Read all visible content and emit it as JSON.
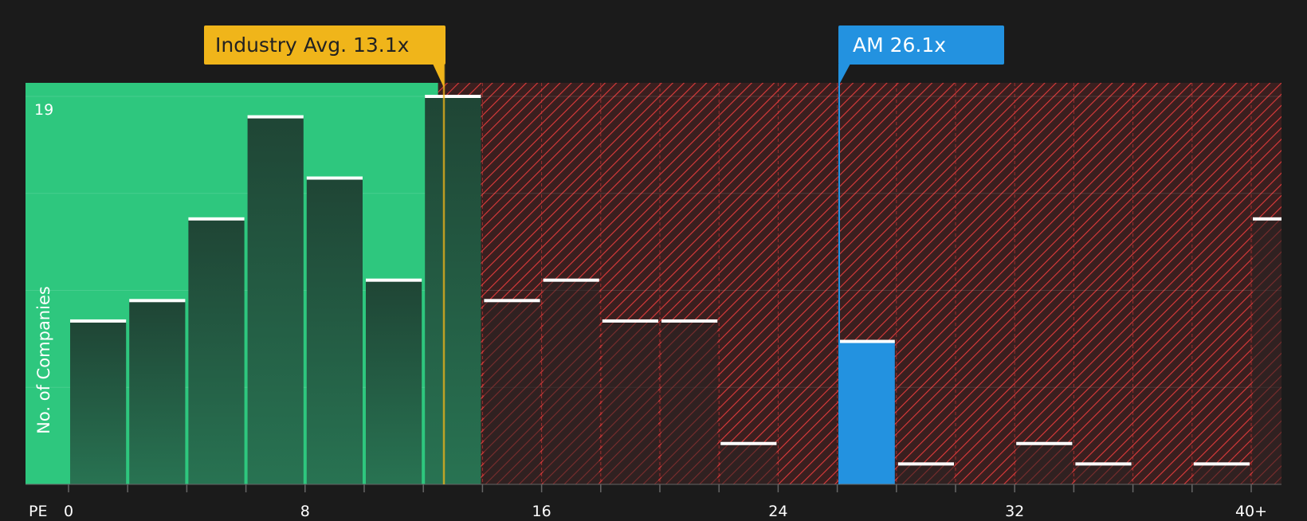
{
  "chart_data": {
    "type": "bar",
    "title": "",
    "xlabel": "PE",
    "ylabel": "No. of Companies",
    "x_ticks": [
      "0",
      "8",
      "16",
      "24",
      "32",
      "40+"
    ],
    "y_max_label": "19",
    "ylim": [
      0,
      19
    ],
    "xlim": [
      0,
      41
    ],
    "bin_width": 2,
    "bars": [
      {
        "x0": 0,
        "x1": 2,
        "value": 8
      },
      {
        "x0": 2,
        "x1": 4,
        "value": 9
      },
      {
        "x0": 4,
        "x1": 6,
        "value": 13
      },
      {
        "x0": 6,
        "x1": 8,
        "value": 18
      },
      {
        "x0": 8,
        "x1": 10,
        "value": 15
      },
      {
        "x0": 10,
        "x1": 12,
        "value": 10
      },
      {
        "x0": 12,
        "x1": 14,
        "value": 19
      },
      {
        "x0": 14,
        "x1": 16,
        "value": 9
      },
      {
        "x0": 16,
        "x1": 18,
        "value": 10
      },
      {
        "x0": 18,
        "x1": 20,
        "value": 8
      },
      {
        "x0": 20,
        "x1": 22,
        "value": 8
      },
      {
        "x0": 22,
        "x1": 24,
        "value": 2
      },
      {
        "x0": 24,
        "x1": 26,
        "value": 0
      },
      {
        "x0": 26,
        "x1": 28,
        "value": 7,
        "highlight": true
      },
      {
        "x0": 28,
        "x1": 30,
        "value": 1
      },
      {
        "x0": 30,
        "x1": 32,
        "value": 0
      },
      {
        "x0": 32,
        "x1": 34,
        "value": 2
      },
      {
        "x0": 34,
        "x1": 36,
        "value": 1
      },
      {
        "x0": 36,
        "x1": 38,
        "value": 0
      },
      {
        "x0": 38,
        "x1": 40,
        "value": 1
      },
      {
        "x0": 40,
        "x1": 41,
        "value": 13
      }
    ],
    "industry_avg": {
      "label": "Industry Avg. 13.1x",
      "value": 13.1,
      "color": "#f0b51a"
    },
    "company": {
      "label": "AM 26.1x",
      "value": 26.1,
      "color": "#2392e0"
    },
    "fair_zone_end": 12.5,
    "colors": {
      "background": "#1b1b1b",
      "green": "#2ec77e",
      "red_hatch": "#e03b3b",
      "bar_dark": "#234a38",
      "bar_top": "#ffffff",
      "text": "#ffffff"
    }
  }
}
